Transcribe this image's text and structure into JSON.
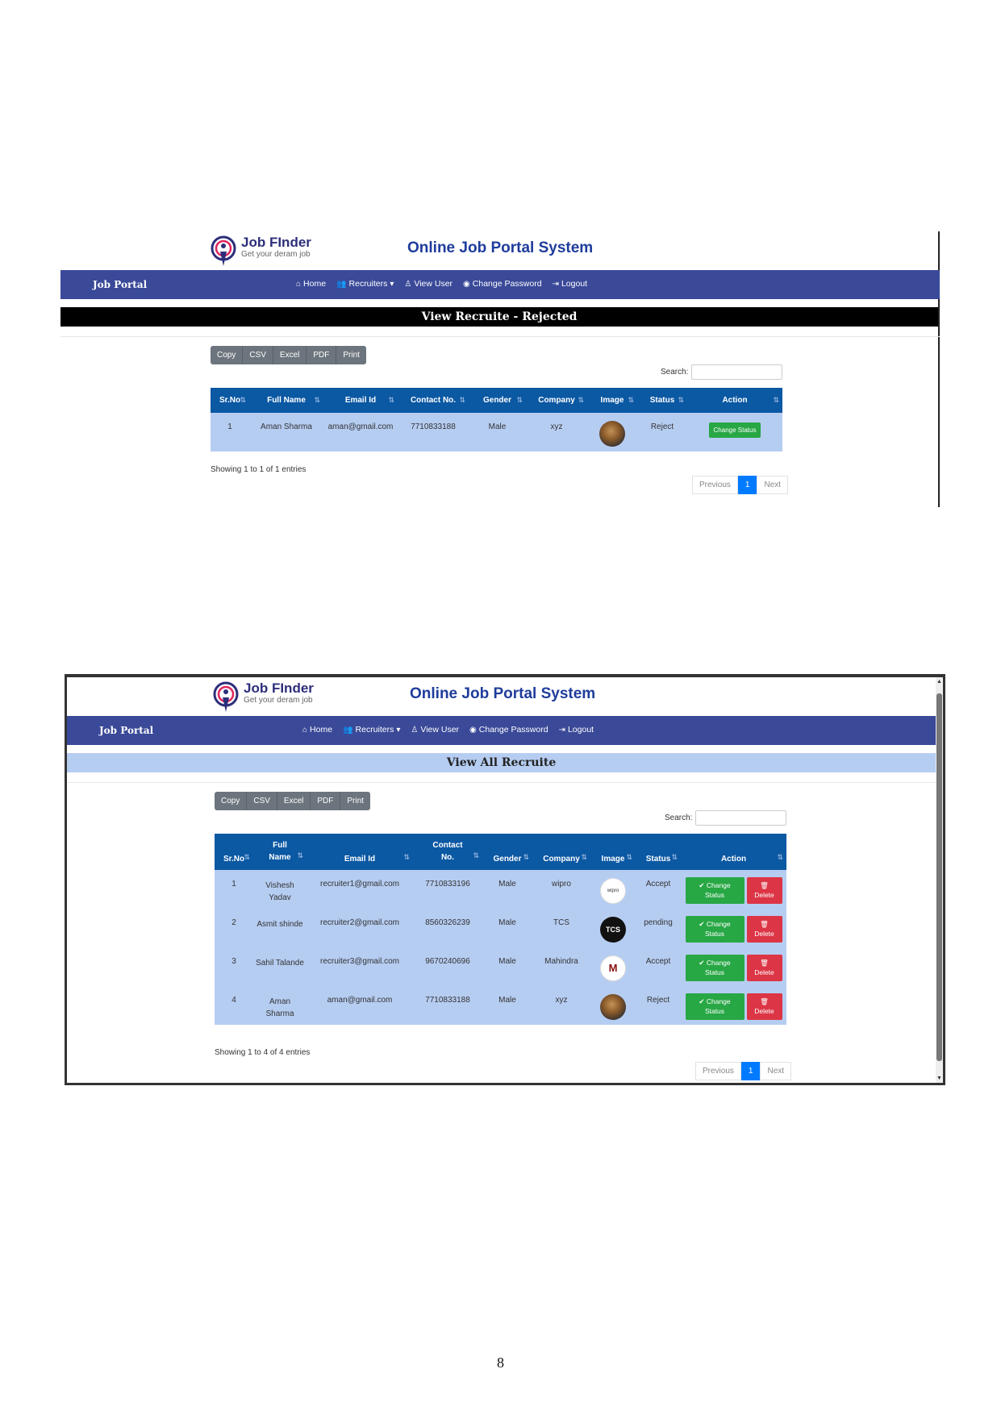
{
  "header": {
    "logo_title": "Job FInder",
    "logo_subtitle": "Get your deram job",
    "site_title": "Online Job Portal System"
  },
  "nav": {
    "brand": "Job Portal",
    "home": "Home",
    "recruiters": "Recruiters",
    "view_user": "View User",
    "change_password": "Change Password",
    "logout": "Logout"
  },
  "buttons": {
    "copy": "Copy",
    "csv": "CSV",
    "excel": "Excel",
    "pdf": "PDF",
    "print": "Print"
  },
  "search_label": "Search:",
  "pagination": {
    "previous": "Previous",
    "page": "1",
    "next": "Next"
  },
  "screen1": {
    "page_title": "View Recruite - Rejected",
    "columns": [
      "Sr.No",
      "Full Name",
      "Email Id",
      "Contact No.",
      "Gender",
      "Company",
      "Image",
      "Status",
      "Action"
    ],
    "rows": [
      {
        "srno": "1",
        "name": "Aman Sharma",
        "email": "aman@gmail.com",
        "contact": "7710833188",
        "gender": "Male",
        "company": "xyz",
        "image": "aman-avatar",
        "status": "Reject",
        "action": "Change Status"
      }
    ],
    "info": "Showing 1 to 1 of 1 entries"
  },
  "screen2": {
    "page_title": "View All Recruite",
    "columns": {
      "srno": "Sr.No",
      "full": "Full",
      "name": "Name",
      "email": "Email Id",
      "contact": "Contact",
      "no": "No.",
      "gender": "Gender",
      "company": "Company",
      "image": "Image",
      "status": "Status",
      "action": "Action"
    },
    "action_change_1": "Change",
    "action_change_2": "Status",
    "action_delete": "Delete",
    "rows": [
      {
        "srno": "1",
        "name1": "Vishesh",
        "name2": "Yadav",
        "email": "recruiter1@gmail.com",
        "contact": "7710833196",
        "gender": "Male",
        "company": "wipro",
        "image": "wipro-logo",
        "logo_text": "wipro",
        "status": "Accept"
      },
      {
        "srno": "2",
        "name1": "Asmit shinde",
        "name2": "",
        "email": "recruiter2@gmail.com",
        "contact": "8560326239",
        "gender": "Male",
        "company": "TCS",
        "image": "tcs-logo",
        "logo_text": "TCS",
        "status": "pending"
      },
      {
        "srno": "3",
        "name1": "Sahil Talande",
        "name2": "",
        "email": "recruiter3@gmail.com",
        "contact": "9670240696",
        "gender": "Male",
        "company": "Mahindra",
        "image": "mahindra-logo",
        "logo_text": "M",
        "status": "Accept"
      },
      {
        "srno": "4",
        "name1": "Aman",
        "name2": "Sharma",
        "email": "aman@gmail.com",
        "contact": "7710833188",
        "gender": "Male",
        "company": "xyz",
        "image": "aman-avatar",
        "logo_text": "",
        "status": "Reject"
      }
    ],
    "info": "Showing 1 to 4 of 4 entries"
  },
  "page_number": "8",
  "colors": {
    "navbar": "#3a4998",
    "table_header": "#0b58a3",
    "row_bg": "#b6cdf2",
    "success": "#28a745",
    "danger": "#dc3545",
    "primary": "#007bff"
  }
}
